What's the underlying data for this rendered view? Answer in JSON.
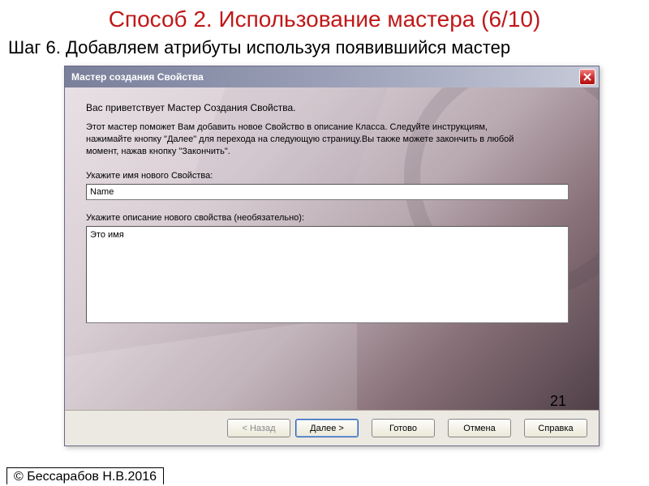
{
  "slide": {
    "title": "Способ 2. Использование мастера (6/10)",
    "subtitle": "Шаг 6. Добавляем атрибуты используя появившийся мастер",
    "page_number": "21",
    "copyright": "© Бессарабов Н.В.2016"
  },
  "dialog": {
    "title": "Мастер создания Свойства",
    "welcome": "Вас приветствует Мастер Создания Свойства.",
    "instructions": "Этот мастер поможет Вам добавить новое Свойство в описание Класса. Следуйте инструкциям, нажимайте кнопку \"Далее\" для перехода на следующую страницу.Вы также можете закончить в любой момент, нажав кнопку \"Закончить\".",
    "name_label": "Укажите имя нового Свойства:",
    "name_value": "Name",
    "desc_label": "Укажите описание нового свойства (необязательно):",
    "desc_value": "Это имя"
  },
  "buttons": {
    "back": "< Назад",
    "next": "Далее >",
    "finish": "Готово",
    "cancel": "Отмена",
    "help": "Справка"
  }
}
